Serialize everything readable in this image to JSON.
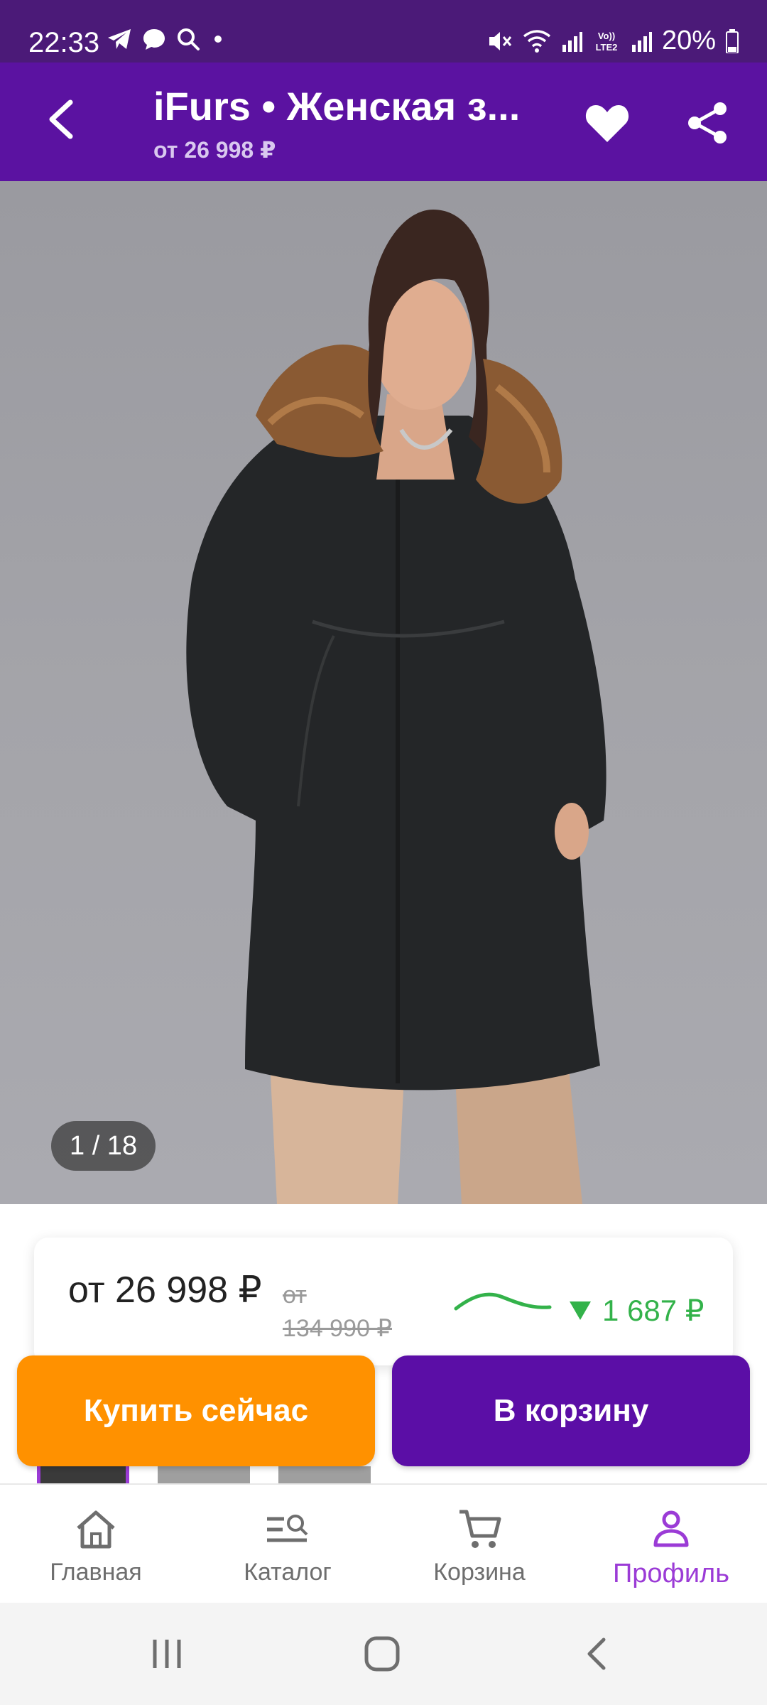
{
  "status_bar": {
    "time": "22:33",
    "battery": "20%",
    "icons_left": [
      "telegram-icon",
      "chat-icon",
      "search-icon",
      "dot-icon"
    ],
    "icons_right": [
      "mute-icon",
      "wifi-icon",
      "signal-icon",
      "volte-icon",
      "signal-icon",
      "battery-icon"
    ]
  },
  "header": {
    "title": "iFurs • Женская з...",
    "subtitle": "от 26 998 ₽",
    "back_icon": "back-arrow-icon",
    "favorite_icon": "heart-icon",
    "share_icon": "share-icon"
  },
  "gallery": {
    "counter": "1 / 18",
    "search_icon": "image-search-icon"
  },
  "price": {
    "current": "от 26 998 ₽",
    "old_label": "от",
    "old": "134 990 ₽",
    "drop": "1 687 ₽",
    "drop_color": "#33b24a"
  },
  "actions": {
    "buy_now": "Купить сейчас",
    "add_to_cart": "В корзину",
    "buy_color": "#ff9100",
    "cart_color": "#5b0ea6"
  },
  "bottom_nav": {
    "items": [
      {
        "label": "Главная",
        "icon": "home-icon"
      },
      {
        "label": "Каталог",
        "icon": "catalog-search-icon"
      },
      {
        "label": "Корзина",
        "icon": "cart-icon"
      },
      {
        "label": "Профиль",
        "icon": "profile-icon",
        "active": true
      }
    ],
    "active_color": "#9b3bd6"
  },
  "colors": {
    "status_bar": "#4b1a78",
    "header": "#5b12a1"
  }
}
